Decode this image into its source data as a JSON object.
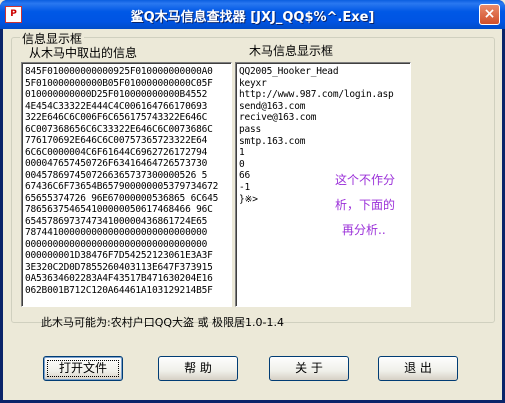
{
  "window": {
    "title": "鲨Q木马信息查找器 [JXJ_QQ$%^.Exe]",
    "close_label": "×"
  },
  "group": {
    "legend": "信息显示框",
    "left_label": "从木马中取出的信息",
    "right_label": "木马信息显示框"
  },
  "hex_lines": [
    "845F010000000000925F010000000000A0",
    "5F010000000000B05F010000000000C05F",
    "010000000000D25F010000000000B4552",
    "4E454C33322E444C4C006164766170693",
    "322E646C6C006F6C656175743322E646C",
    "6C007368656C6C33322E646C6C0073686C",
    "776170692E646C6C00757365723322E64",
    "6C6C0000004C6F61644C6962726172794",
    "000047657450726F63416464726573730",
    "0045786974507266365737300000526 5",
    "67436C6F73654B657900000005379734672",
    "65655374726 96E67000000536865 6C645",
    "786563754654100000050617468466 96C",
    "654578697374734100000436861724E65",
    "787441000000000000000000000000000",
    "000000000000000000000000000000000",
    "000000001D38476F7D54252123061E3A3F",
    "3E320C2D0D7855260403113E647F373915",
    "0A53634602283A4F43517B471630204E16",
    "062B001B712C120A64461A103129214B5F"
  ],
  "info_lines": [
    "QQ2005_Hooker_Head",
    "keyxr",
    "http://www.987.com/login.asp",
    "send@163.com",
    "recive@163.com",
    "pass",
    "smtp.163.com",
    "1",
    "0",
    "66",
    "-1",
    "}※>"
  ],
  "annotation": {
    "line1": "这个不作分",
    "line2": "析，下面的",
    "line3": "再分析.."
  },
  "verdict": "此木马可能为:农村户口QQ大盗 或 极限居1.0-1.4",
  "buttons": {
    "open": "打开文件",
    "help": "帮 助",
    "about": "关 于",
    "exit": "退 出"
  }
}
